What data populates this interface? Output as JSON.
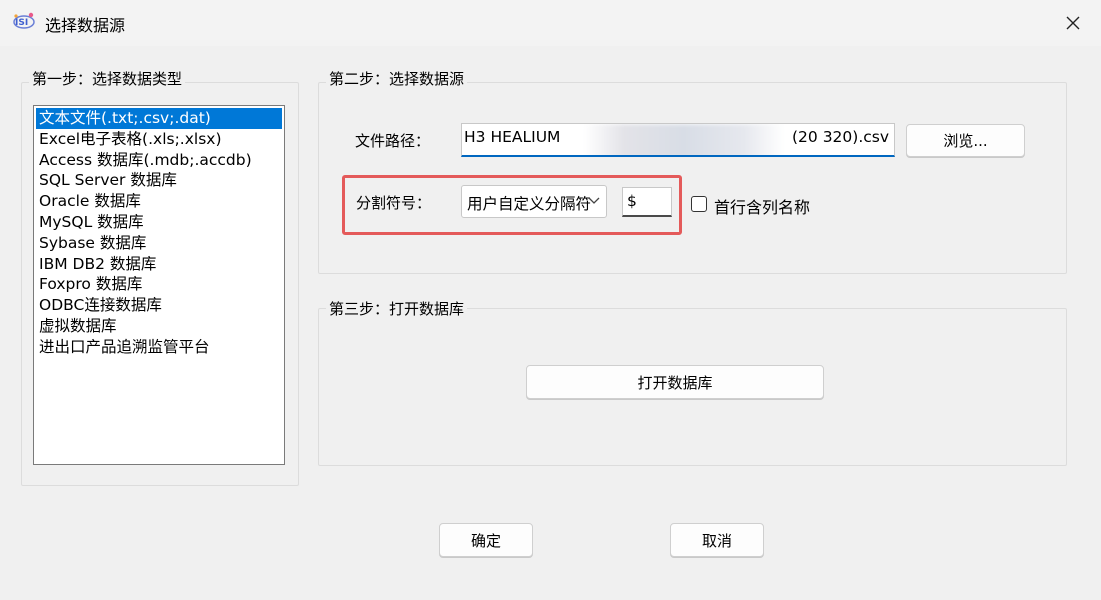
{
  "window": {
    "title": "选择数据源",
    "icon": "app-logo-icon",
    "close_icon": "close-icon"
  },
  "step1": {
    "title": "第一步：选择数据类型",
    "selected_index": 0,
    "items": [
      "文本文件(.txt;.csv;.dat)",
      "Excel电子表格(.xls;.xlsx)",
      "Access 数据库(.mdb;.accdb)",
      "SQL Server 数据库",
      "Oracle 数据库",
      "MySQL 数据库",
      "Sybase 数据库",
      "IBM DB2 数据库",
      "Foxpro 数据库",
      "ODBC连接数据库",
      "虚拟数据库",
      "进出口产品追溯监管平台"
    ]
  },
  "step2": {
    "title": "第二步：选择数据源",
    "path_label": "文件路径：",
    "path_value_start": "H3  HEALIUM",
    "path_value_end": "(20 320).csv",
    "browse_label": "浏览...",
    "separator_label": "分割符号：",
    "separator_type": "用户自定义分隔符",
    "separator_value": "$",
    "header_checkbox_label": "首行含列名称",
    "header_checkbox_checked": false,
    "highlight_color": "#e45a5a"
  },
  "step3": {
    "title": "第三步：打开数据库",
    "open_button_label": "打开数据库"
  },
  "footer": {
    "ok_label": "确定",
    "cancel_label": "取消"
  },
  "colors": {
    "selection": "#0078d7",
    "input_focus": "#0067c0",
    "background": "#f0f0f0"
  }
}
